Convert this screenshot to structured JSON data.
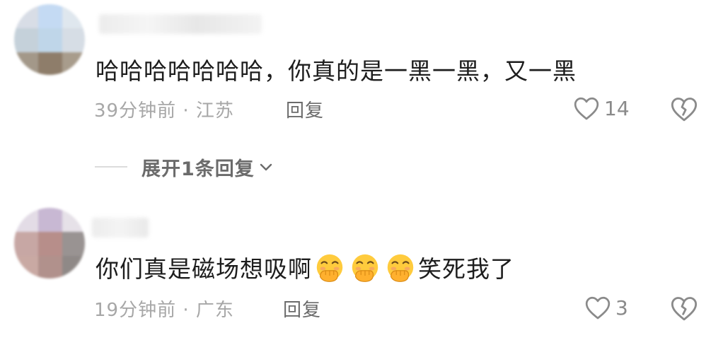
{
  "comments": [
    {
      "text": "哈哈哈哈哈哈哈，你真的是一黑一黑，又一黑",
      "time": "39分钟前",
      "location": "江苏",
      "reply_label": "回复",
      "likes": "14",
      "expand_label": "展开1条回复"
    },
    {
      "text_before": "你们真是磁场想吸啊",
      "emoji_name": "hand-over-mouth-emoji",
      "text_after": "笑死我了",
      "time": "19分钟前",
      "location": "广东",
      "reply_label": "回复",
      "likes": "3"
    }
  ],
  "separator": "·",
  "colors": {
    "primary_text": "#1d1d1d",
    "meta_text": "#a7a7a7",
    "action_text": "#6b6b6b",
    "icon": "#8a8a8a"
  },
  "icons": {
    "like": "heart-outline-icon",
    "dislike": "broken-heart-icon",
    "expand": "chevron-down-icon"
  }
}
